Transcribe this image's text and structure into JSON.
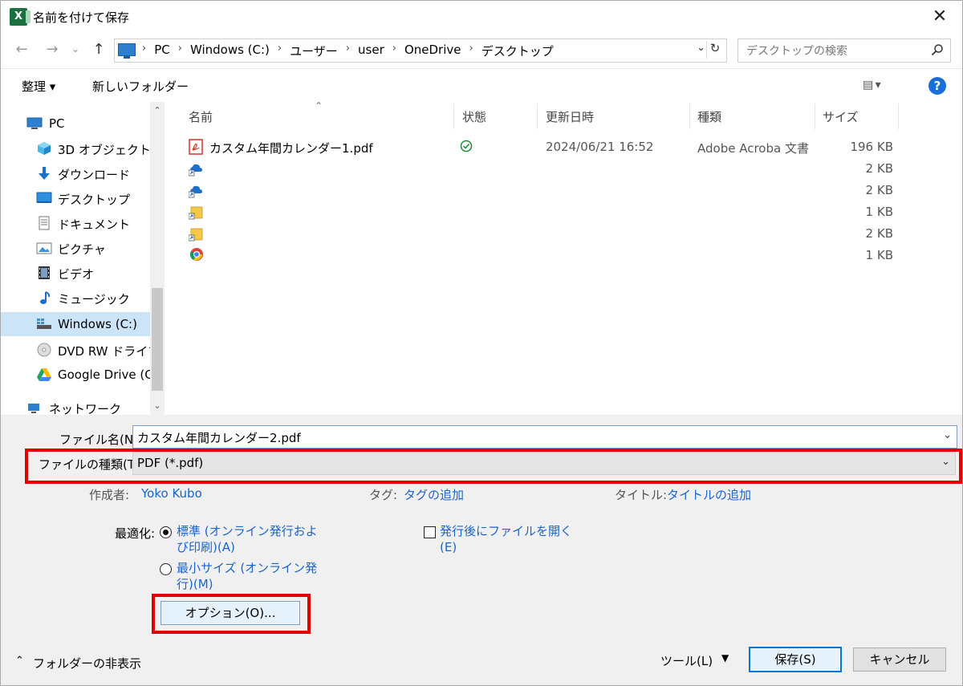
{
  "window": {
    "title": "名前を付けて保存",
    "app_icon": "X",
    "close_label": "✕"
  },
  "nav": {
    "back": "←",
    "forward": "→",
    "recent": "⌄",
    "up": "↑",
    "breadcrumb": [
      "PC",
      "Windows (C:)",
      "ユーザー",
      "user",
      "OneDrive",
      "デスクトップ"
    ],
    "search_placeholder": "デスクトップの検索"
  },
  "toolbar": {
    "organize": "整理 ▾",
    "new_folder": "新しいフォルダー",
    "view_icon": "▤ ▾",
    "help": "?"
  },
  "sidebar": {
    "items": [
      {
        "label": "PC",
        "icon": "pc-icon"
      },
      {
        "label": "3D オブジェクト",
        "icon": "3d-objects-icon"
      },
      {
        "label": "ダウンロード",
        "icon": "download-icon"
      },
      {
        "label": "デスクトップ",
        "icon": "desktop-icon"
      },
      {
        "label": "ドキュメント",
        "icon": "documents-icon"
      },
      {
        "label": "ピクチャ",
        "icon": "pictures-icon"
      },
      {
        "label": "ビデオ",
        "icon": "videos-icon"
      },
      {
        "label": "ミュージック",
        "icon": "music-icon"
      },
      {
        "label": "Windows (C:)",
        "icon": "drive-icon"
      },
      {
        "label": "DVD RW ドライブ (",
        "icon": "dvd-icon"
      },
      {
        "label": "Google Drive (G:",
        "icon": "google-drive-icon"
      },
      {
        "label": "ネットワーク",
        "icon": "network-icon"
      }
    ]
  },
  "files": {
    "columns": {
      "name": "名前",
      "status": "状態",
      "date": "更新日時",
      "type": "種類",
      "size": "サイズ"
    },
    "rows": [
      {
        "name": "カスタム年間カレンダー1.pdf",
        "date": "2024/06/21 16:52",
        "type": "Adobe Acroba 文書",
        "size": "196 KB",
        "icon": "pdf-icon"
      },
      {
        "name": "",
        "date": "",
        "type": "",
        "size": "2 KB",
        "icon": "onedrive-shortcut-icon"
      },
      {
        "name": "",
        "date": "",
        "type": "",
        "size": "2 KB",
        "icon": "onedrive-shortcut-icon"
      },
      {
        "name": "",
        "date": "",
        "type": "",
        "size": "1 KB",
        "icon": "folder-shortcut-icon"
      },
      {
        "name": "",
        "date": "",
        "type": "",
        "size": "2 KB",
        "icon": "folder-shortcut-icon"
      },
      {
        "name": "",
        "date": "",
        "type": "",
        "size": "1 KB",
        "icon": "chrome-shortcut-icon"
      }
    ]
  },
  "form": {
    "filename_label": "ファイル名(N):",
    "filename_value": "カスタム年間カレンダー2.pdf",
    "filetype_label": "ファイルの種類(T):",
    "filetype_value": "PDF (*.pdf)",
    "author_label": "作成者:",
    "author_value": "Yoko Kubo",
    "tags_label": "タグ:",
    "tags_value": "タグの追加",
    "title_label": "タイトル:",
    "title_value": "タイトルの追加",
    "optimize_label": "最適化:",
    "opt_standard_line1": "標準 (オンライン発行およ",
    "opt_standard_line2": "び印刷)(A)",
    "opt_min_line1": "最小サイズ (オンライン発",
    "opt_min_line2": "行)(M)",
    "open_after_line1": "発行後にファイルを開く",
    "open_after_line2": "(E)",
    "options_button": "オプション(O)..."
  },
  "footer": {
    "hide_folders": "フォルダーの非表示",
    "tools": "ツール(L)",
    "save": "保存(S)",
    "cancel": "キャンセル"
  },
  "colors": {
    "accent": "#0078d7",
    "link": "#1a64c8",
    "highlight_box": "#e00000",
    "selected_nav": "#cce4f7"
  }
}
